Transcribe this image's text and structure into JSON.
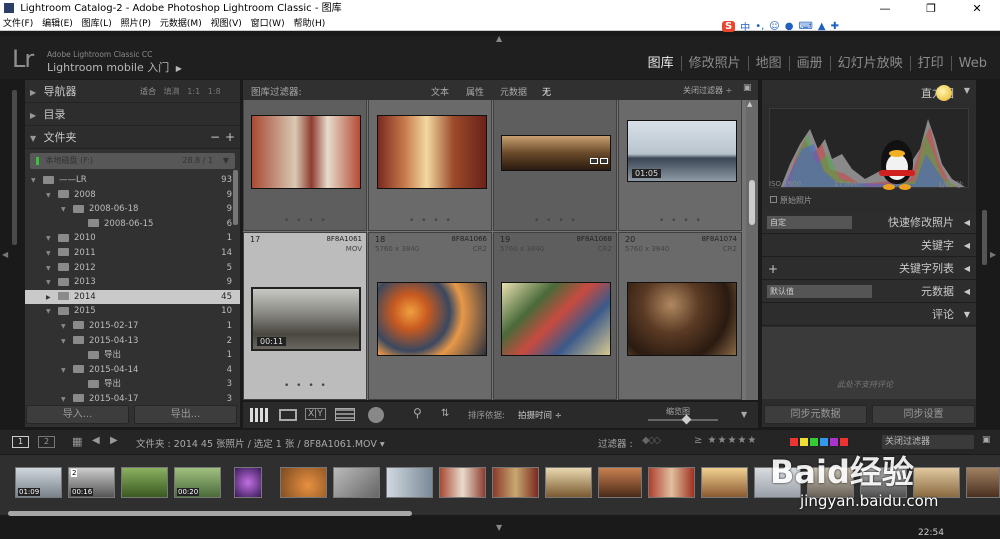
{
  "window": {
    "title": "Lightroom Catalog-2 - Adobe Photoshop Lightroom Classic - 图库",
    "min": "—",
    "max": "❐",
    "close": "✕"
  },
  "menu": [
    "文件(F)",
    "编辑(E)",
    "图库(L)",
    "照片(P)",
    "元数据(M)",
    "视图(V)",
    "窗口(W)",
    "帮助(H)"
  ],
  "ime": {
    "logo": "S",
    "lang": "中",
    "punct": "•,",
    "emoji": "☺",
    "mic": "🎤",
    "kbd": "⌨",
    "shirt": "👕",
    "tool": "🔧"
  },
  "brand": {
    "logo": "Lr",
    "product": "Adobe Lightroom Classic CC",
    "mobile": "Lightroom mobile 入门",
    "arrow": "▶"
  },
  "modules": [
    "图库",
    "修改照片",
    "地图",
    "画册",
    "幻灯片放映",
    "打印",
    "Web"
  ],
  "left": {
    "navigator": "导航器",
    "nav_opts": [
      "适合",
      "填满",
      "1:1",
      "1:8"
    ],
    "catalog": "目录",
    "folders": "文件夹",
    "folders_minus": "−",
    "folders_plus": "+",
    "volume": {
      "name": "本地磁盘 (F:)",
      "size": "28.8 / 1"
    },
    "tree": [
      {
        "name": "——LR",
        "count": "93",
        "level": 0
      },
      {
        "name": "2008",
        "count": "9",
        "level": 1
      },
      {
        "name": "2008-06-18",
        "count": "9",
        "level": 2
      },
      {
        "name": "2008-06-15",
        "count": "6",
        "level": 3
      },
      {
        "name": "2010",
        "count": "1",
        "level": 1
      },
      {
        "name": "2011",
        "count": "14",
        "level": 1
      },
      {
        "name": "2012",
        "count": "5",
        "level": 1
      },
      {
        "name": "2013",
        "count": "9",
        "level": 1
      },
      {
        "name": "2014",
        "count": "45",
        "level": 1,
        "sel": true
      },
      {
        "name": "2015",
        "count": "10",
        "level": 1
      },
      {
        "name": "2015-02-17",
        "count": "1",
        "level": 2
      },
      {
        "name": "2015-04-13",
        "count": "2",
        "level": 2
      },
      {
        "name": "导出",
        "count": "1",
        "level": 3
      },
      {
        "name": "2015-04-14",
        "count": "4",
        "level": 2
      },
      {
        "name": "导出",
        "count": "3",
        "level": 3
      },
      {
        "name": "2015-04-17",
        "count": "3",
        "level": 2
      }
    ],
    "import": "导入...",
    "export": "导出..."
  },
  "filter": {
    "label": "图库过滤器:",
    "opts": [
      "文本",
      "属性",
      "元数据",
      "无"
    ],
    "off": "关闭过滤器 ÷",
    "lock": "🔒"
  },
  "grid": [
    {
      "num": "",
      "fn": "",
      "dim": "",
      "ext": "",
      "dur": ""
    },
    {
      "num": "",
      "fn": "",
      "dim": "",
      "ext": "",
      "dur": ""
    },
    {
      "num": "",
      "fn": "",
      "dim": "",
      "ext": "",
      "dur": ""
    },
    {
      "num": "",
      "fn": "",
      "dim": "",
      "ext": "",
      "dur": "01:05"
    },
    {
      "num": "17",
      "fn": "8F8A1061",
      "dim": "",
      "ext": "MOV",
      "dur": "00:11"
    },
    {
      "num": "18",
      "fn": "8F8A1066",
      "dim": "5760 x 3840",
      "ext": "CR2",
      "dur": ""
    },
    {
      "num": "19",
      "fn": "8F8A1068",
      "dim": "5760 x 3840",
      "ext": "CR2",
      "dur": ""
    },
    {
      "num": "20",
      "fn": "8F8A1074",
      "dim": "5760 x 3840",
      "ext": "CR2",
      "dur": ""
    }
  ],
  "toolbar": {
    "sort_label": "排序依据:",
    "sort_value": "拍摄时间 ÷",
    "thumb_label": "缩览图"
  },
  "right": {
    "histogram": "直方图",
    "iso": "ISO 1600",
    "focal": "17 mm",
    "shutter": "1/41 秒",
    "original": "原始照片",
    "quick_preset": "自定",
    "quick": "快速修改照片",
    "keyword": "关键字",
    "keyword_list": "关键字列表",
    "meta_preset": "默认值",
    "metadata": "元数据",
    "comments": "评论",
    "no_comment": "此处不支持评论",
    "sync_meta": "同步元数据",
    "sync_settings": "同步设置"
  },
  "filmbar": {
    "p1": "1",
    "p2": "2",
    "path": "文件夹 : 2014   45 张照片 / 选定 1 张 / 8F8A1061.MOV ▾",
    "filter_label": "过滤器 :",
    "filter_off": "关闭过滤器"
  },
  "film_durations": [
    "01:09",
    "00:16",
    "",
    "00:20"
  ],
  "watermark": {
    "text": "Baid经验",
    "url": "jingyan.baidu.com"
  },
  "clock": "22:54"
}
